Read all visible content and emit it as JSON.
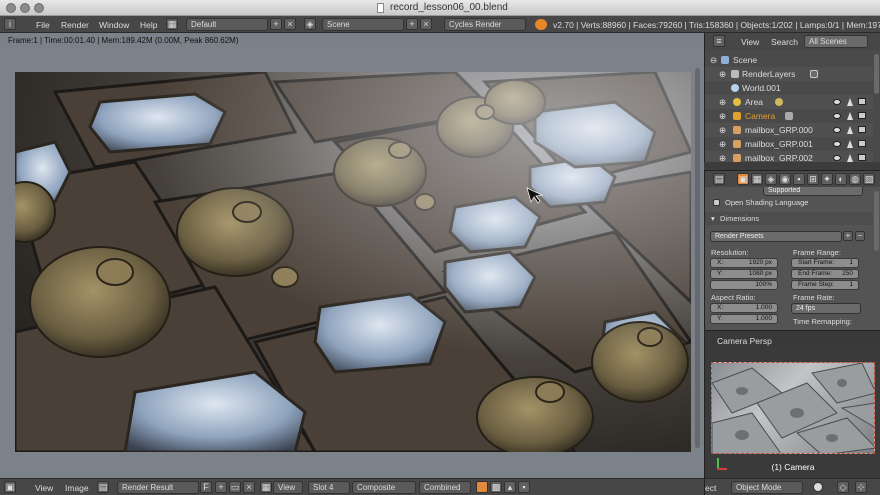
{
  "window": {
    "title": "record_lesson06_00.blend"
  },
  "info_header": {
    "menus": [
      "File",
      "Render",
      "Window",
      "Help"
    ],
    "layout": "Default",
    "scene": "Scene",
    "engine": "Cycles Render",
    "stats": "v2.70 | Verts:88960 | Faces:79260 | Tris:158360 | Objects:1/202 | Lamps:0/1 | Mem:197.36M"
  },
  "viewport": {
    "status": "Frame:1 | Time:00:01.40 | Mem:189.42M (0.00M, Peak 860.62M)"
  },
  "image_editor": {
    "view_label": "View",
    "image_label": "Image",
    "image_name": "Render Result",
    "fake_user": "F",
    "view_dropdown": "View",
    "slot": "Slot 4",
    "layer": "Composite",
    "pass": "Combined"
  },
  "outliner": {
    "tabs": [
      "View",
      "Search",
      "All Scenes"
    ],
    "rows": [
      "Scene",
      "RenderLayers",
      "World.001",
      "Area",
      "Camera",
      "mailbox_GRP.000",
      "mailbox_GRP.001",
      "mailbox_GRP.002"
    ]
  },
  "properties": {
    "supported_value": "Supported",
    "osl_label": "Open Shading Language",
    "dimensions_label": "Dimensions",
    "render_presets": "Render Presets",
    "resolution_label": "Resolution:",
    "res_x_key": "X:",
    "res_x_val": "1920 px",
    "res_y_key": "Y:",
    "res_y_val": "1080 px",
    "res_pct": "100%",
    "frame_range_label": "Frame Range:",
    "start_key": "Start Frame:",
    "start_val": "1",
    "end_key": "End Frame:",
    "end_val": "250",
    "step_key": "Frame Step:",
    "step_val": "1",
    "aspect_label": "Aspect Ratio:",
    "asp_x_key": "X:",
    "asp_x_val": "1.000",
    "asp_y_key": "Y:",
    "asp_y_val": "1.000",
    "frame_rate_label": "Frame Rate:",
    "fps": "24 fps",
    "time_remap_label": "Time Remapping:"
  },
  "camera_view": {
    "title": "Camera Persp",
    "label": "(1) Camera"
  },
  "view3d_footer": {
    "mode_partial": "ect",
    "mode": "Object Mode"
  },
  "colors": {
    "camera_orange": "#e0a030",
    "selection_red": "#c24b3a"
  }
}
